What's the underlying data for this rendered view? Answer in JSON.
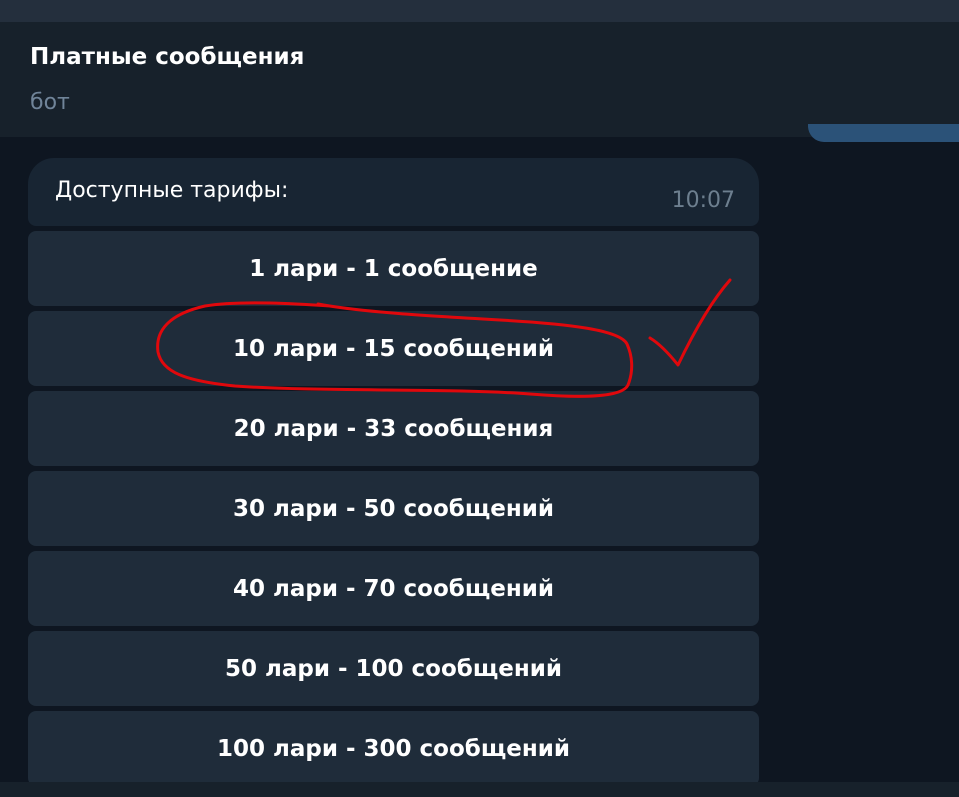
{
  "chat": {
    "title": "Платные сообщения",
    "subtitle": "бот"
  },
  "message": {
    "text": "Доступные тарифы:",
    "time": "10:07"
  },
  "keyboard": {
    "buttons": [
      {
        "label": "1 лари - 1 сообщение"
      },
      {
        "label": "10 лари - 15 сообщений"
      },
      {
        "label": "20 лари - 33 сообщения"
      },
      {
        "label": "30 лари - 50 сообщений"
      },
      {
        "label": "40 лари - 70 сообщений"
      },
      {
        "label": "50 лари - 100 сообщений"
      },
      {
        "label": "100 лари - 300 сообщений"
      }
    ]
  },
  "colors": {
    "background": "#0e1621",
    "header": "#17212b",
    "bubble": "#182533",
    "button": "#1f2c3a",
    "outgoing": "#2b5278",
    "annotation_red": "#e0080c"
  }
}
